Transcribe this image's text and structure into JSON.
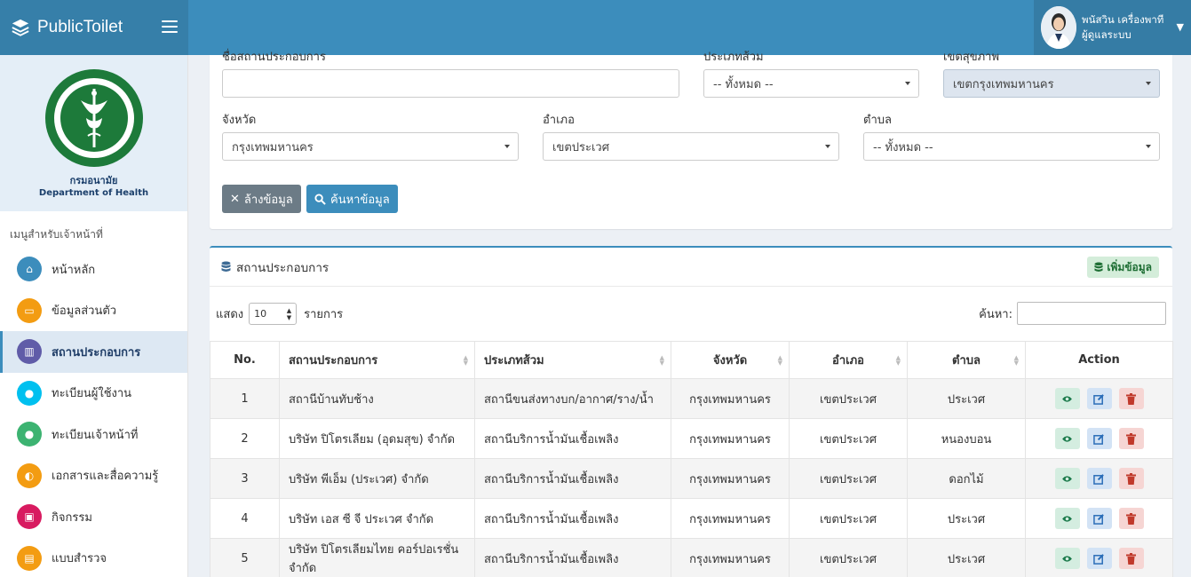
{
  "header": {
    "brand": "PublicToilet",
    "user_name": "พนัสวิน เครื่องพาที",
    "user_role": "ผู้ดูแลระบบ"
  },
  "sidebar": {
    "dept_th": "กรมอนามัย",
    "dept_en": "Department of Health",
    "menu_heading": "เมนูสำหรับเจ้าหน้าที่",
    "items": [
      {
        "label": "หน้าหลัก",
        "icon": "home-icon",
        "color": "#3c8dbc"
      },
      {
        "label": "ข้อมูลส่วนตัว",
        "icon": "id-card-icon",
        "color": "#f39c12"
      },
      {
        "label": "สถานประกอบการ",
        "icon": "building-icon",
        "color": "#605ca8"
      },
      {
        "label": "ทะเบียนผู้ใช้งาน",
        "icon": "user-icon",
        "color": "#00c0ef"
      },
      {
        "label": "ทะเบียนเจ้าหน้าที่",
        "icon": "user-cog-icon",
        "color": "#3cb371"
      },
      {
        "label": "เอกสารและสื่อความรู้",
        "icon": "lightbulb-icon",
        "color": "#f39c12"
      },
      {
        "label": "กิจกรรม",
        "icon": "image-icon",
        "color": "#d81b60"
      },
      {
        "label": "แบบสำรวจ",
        "icon": "clipboard-icon",
        "color": "#f39c12"
      }
    ]
  },
  "filters": {
    "name_label": "ชื่อสถานประกอบการ",
    "name_value": "",
    "type_label": "ประเภทส้วม",
    "type_value": "-- ทั้งหมด --",
    "region_label": "เขตสุขภาพ",
    "region_value": "เขตกรุงเทพมหานคร",
    "province_label": "จังหวัด",
    "province_value": "กรุงเทพมหานคร",
    "district_label": "อำเภอ",
    "district_value": "เขตประเวศ",
    "subdistrict_label": "ตำบล",
    "subdistrict_value": "-- ทั้งหมด --",
    "clear_label": "ล้างข้อมูล",
    "search_label": "ค้นหาข้อมูล"
  },
  "list": {
    "title": "สถานประกอบการ",
    "add_label": "เพิ่มข้อมูล",
    "show_label": "แสดง",
    "page_size": "10",
    "items_label": "รายการ",
    "search_label": "ค้นหา:",
    "columns": [
      "No.",
      "สถานประกอบการ",
      "ประเภทส้วม",
      "จังหวัด",
      "อำเภอ",
      "ตำบล",
      "Action"
    ],
    "rows": [
      {
        "no": "1",
        "name": "สถานีบ้านทับช้าง",
        "type": "สถานีขนส่งทางบก/อากาศ/ราง/น้ำ",
        "province": "กรุงเทพมหานคร",
        "district": "เขตประเวศ",
        "subdistrict": "ประเวศ"
      },
      {
        "no": "2",
        "name": "บริษัท ปิโตรเลียม (อุดมสุข) จำกัด",
        "type": "สถานีบริการน้ำมันเชื้อเพลิง",
        "province": "กรุงเทพมหานคร",
        "district": "เขตประเวศ",
        "subdistrict": "หนองบอน"
      },
      {
        "no": "3",
        "name": "บริษัท พีเอ็ม (ประเวศ) จำกัด",
        "type": "สถานีบริการน้ำมันเชื้อเพลิง",
        "province": "กรุงเทพมหานคร",
        "district": "เขตประเวศ",
        "subdistrict": "ดอกไม้"
      },
      {
        "no": "4",
        "name": "บริษัท เอส ซี จี ประเวศ จำกัด",
        "type": "สถานีบริการน้ำมันเชื้อเพลิง",
        "province": "กรุงเทพมหานคร",
        "district": "เขตประเวศ",
        "subdistrict": "ประเวศ"
      },
      {
        "no": "5",
        "name": "บริษัท ปิโตรเลียมไทย คอร์ปอเรชั่น จำกัด",
        "type": "สถานีบริการน้ำมันเชื้อเพลิง",
        "province": "กรุงเทพมหานคร",
        "district": "เขตประเวศ",
        "subdistrict": "ประเวศ"
      }
    ]
  }
}
